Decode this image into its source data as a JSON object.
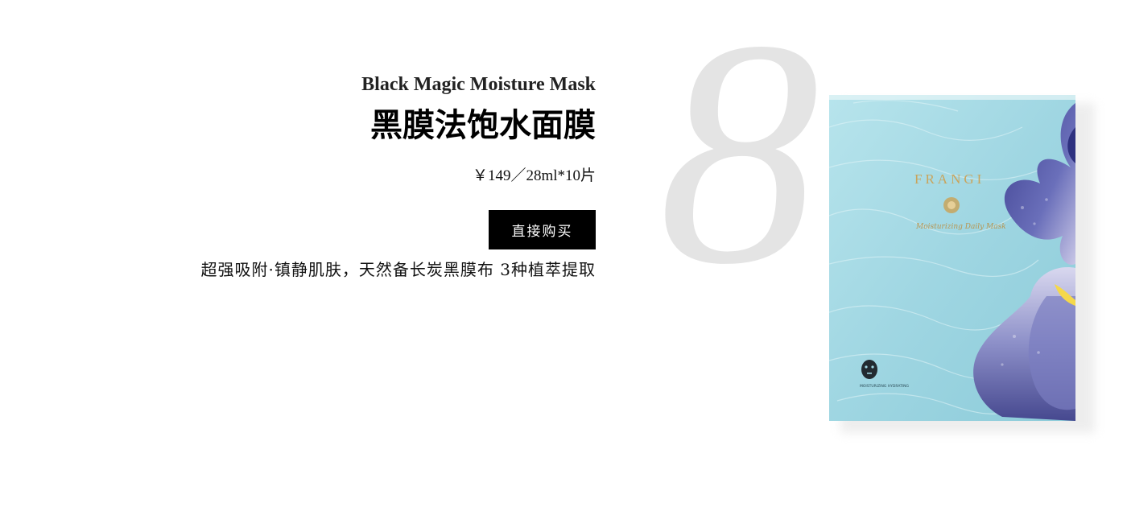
{
  "product": {
    "number": "8",
    "name_en": "Black Magic Moisture Mask",
    "name_cn": "黑膜法饱水面膜",
    "price": "￥149／28ml*10片",
    "buy_label": "直接购买",
    "description": "超强吸附·镇静肌肤，天然备长炭黑膜布 3种植萃提取"
  },
  "package": {
    "brand": "FRANGI",
    "script_line": "Moisturizing Daily Mask",
    "badge": "MOISTURIZING HYDRATING"
  },
  "colors": {
    "button_bg": "#000000",
    "button_text": "#ffffff",
    "number_color": "#e4e4e4",
    "package_blue": "#a9dde6",
    "flower_purple": "#5a60ad"
  }
}
